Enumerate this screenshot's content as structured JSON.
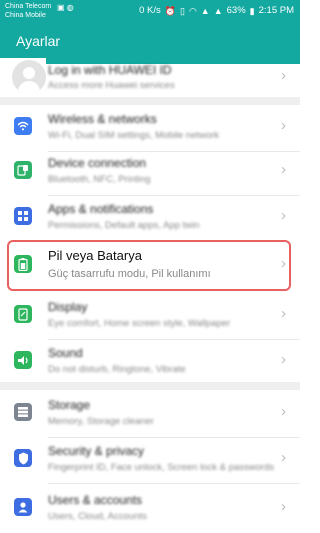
{
  "status_bar": {
    "carrier1": "China Telecom",
    "carrier2": "China Mobile",
    "speed": "0 K/s",
    "battery": "63%",
    "time": "2:15 PM",
    "signal_label": "4G",
    "signal2_label": "2G"
  },
  "app_bar": {
    "title": "Ayarlar"
  },
  "account": {
    "title": "Log in with HUAWEI ID",
    "subtitle": "Access more Huawei services"
  },
  "rows": [
    {
      "title": "Wireless & networks",
      "subtitle": "Wi-Fi, Dual SIM settings, Mobile network",
      "icon": "wifi-icon",
      "color": "#3d7cf1"
    },
    {
      "title": "Device connection",
      "subtitle": "Bluetooth, NFC, Printing",
      "icon": "device-connection-icon",
      "color": "#2fb36a"
    },
    {
      "title": "Apps & notifications",
      "subtitle": "Permissions, Default apps, App twin",
      "icon": "apps-icon",
      "color": "#3d6de0"
    },
    {
      "title": "Pil veya Batarya",
      "subtitle": "Güç tasarrufu modu, Pil kullanımı",
      "icon": "battery-icon",
      "color": "#2db65e"
    },
    {
      "title": "Display",
      "subtitle": "Eye comfort, Home screen style, Wallpaper",
      "icon": "display-icon",
      "color": "#2db65e"
    },
    {
      "title": "Sound",
      "subtitle": "Do not disturb, Ringtone, Vibrate",
      "icon": "sound-icon",
      "color": "#2db65e"
    },
    {
      "title": "Storage",
      "subtitle": "Memory, Storage cleaner",
      "icon": "storage-icon",
      "color": "#7d8590"
    },
    {
      "title": "Security & privacy",
      "subtitle": "Fingerprint ID, Face unlock, Screen lock & passwords",
      "icon": "security-icon",
      "color": "#3d6de0"
    },
    {
      "title": "Users & accounts",
      "subtitle": "Users, Cloud, Accounts",
      "icon": "users-icon",
      "color": "#3d6de0"
    }
  ],
  "chevron": "›"
}
